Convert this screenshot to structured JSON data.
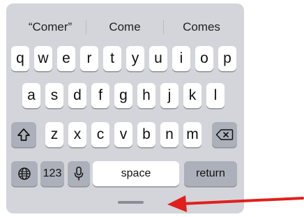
{
  "suggestions": [
    "“Comer”",
    "Come",
    "Comes"
  ],
  "rows": {
    "row1": [
      "q",
      "w",
      "e",
      "r",
      "t",
      "y",
      "u",
      "i",
      "o",
      "p"
    ],
    "row2": [
      "a",
      "s",
      "d",
      "f",
      "g",
      "h",
      "j",
      "k",
      "l"
    ],
    "row3": [
      "z",
      "x",
      "c",
      "v",
      "b",
      "n",
      "m"
    ]
  },
  "keys": {
    "numbers_label": "123",
    "space_label": "space",
    "return_label": "return",
    "shift_icon": "shift-icon",
    "delete_icon": "delete-icon",
    "globe_icon": "globe-icon",
    "mic_icon": "microphone-icon"
  },
  "annotation": {
    "arrow_color": "#e0201b",
    "arrow_target": "home-indicator"
  }
}
